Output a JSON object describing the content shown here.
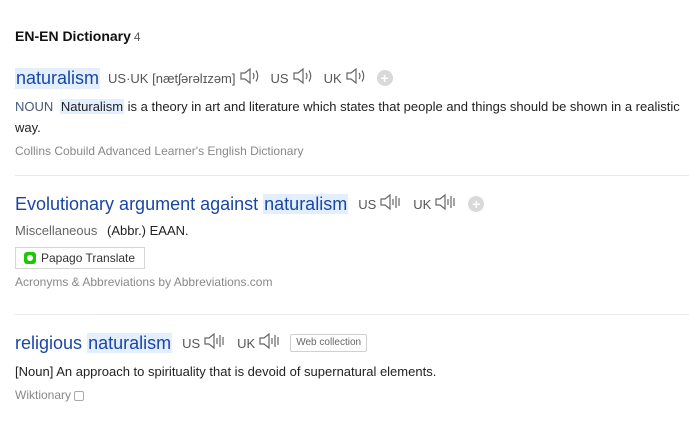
{
  "section": {
    "title": "EN-EN Dictionary",
    "count": "4"
  },
  "entries": [
    {
      "headword": "naturalism",
      "phonetic_label": "US·UK",
      "phonetic": "[nætʃərəlɪzəm]",
      "us": "US",
      "uk": "UK",
      "pos": "NOUN",
      "highlight": "Naturalism",
      "definition": " is a theory in art and literature which states that people and things should be shown in a realistic way.",
      "source": "Collins Cobuild Advanced Learner's English Dictionary"
    },
    {
      "headword_prefix": "Evolutionary argument against",
      "headword_highlight": "naturalism",
      "us": "US",
      "uk": "UK",
      "category": "Miscellaneous",
      "abbr": "(Abbr.) EAAN.",
      "papago_label": "Papago Translate",
      "source": "Acronyms & Abbreviations by Abbreviations.com"
    },
    {
      "headword_prefix": "religious",
      "headword_highlight": "naturalism",
      "us": "US",
      "uk": "UK",
      "badge": "Web collection",
      "definition": "[Noun] An approach to spirituality that is devoid of supernatural elements.",
      "source": "Wiktionary"
    }
  ]
}
